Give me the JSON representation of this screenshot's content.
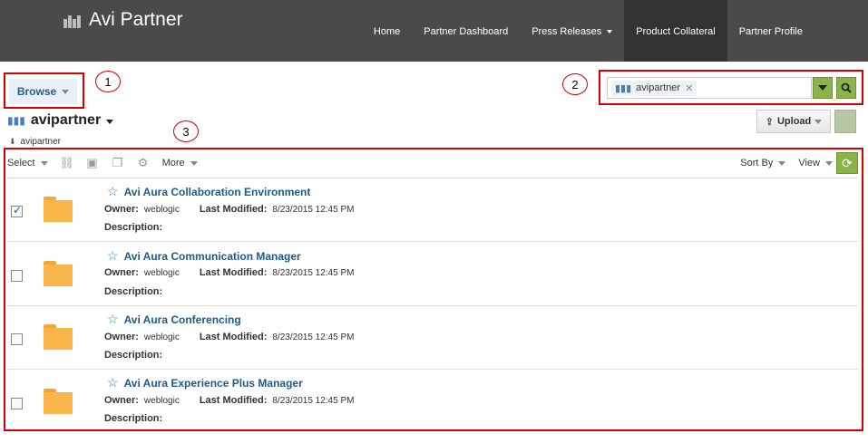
{
  "app": {
    "title": "Avi Partner"
  },
  "nav": [
    {
      "label": "Home"
    },
    {
      "label": "Partner Dashboard"
    },
    {
      "label": "Press Releases"
    },
    {
      "label": "Product Collateral"
    },
    {
      "label": "Partner Profile"
    }
  ],
  "browse": {
    "label": "Browse"
  },
  "search": {
    "token": "avipartner"
  },
  "folder": {
    "title": "avipartner",
    "breadcrumb": "avipartner"
  },
  "upload": {
    "label": "Upload"
  },
  "toolbar": {
    "select": "Select",
    "more": "More",
    "sort_by": "Sort By",
    "view": "View"
  },
  "callouts": [
    "1",
    "2",
    "3"
  ],
  "items": [
    {
      "name": "Avi Aura Collaboration Environment",
      "owner_label": "Owner:",
      "owner": "weblogic",
      "modified_label": "Last Modified:",
      "modified": "8/23/2015 12:45 PM",
      "desc_label": "Description:",
      "checked": true
    },
    {
      "name": "Avi Aura Communication Manager",
      "owner_label": "Owner:",
      "owner": "weblogic",
      "modified_label": "Last Modified:",
      "modified": "8/23/2015 12:45 PM",
      "desc_label": "Description:",
      "checked": false
    },
    {
      "name": "Avi Aura Conferencing",
      "owner_label": "Owner:",
      "owner": "weblogic",
      "modified_label": "Last Modified:",
      "modified": "8/23/2015 12:45 PM",
      "desc_label": "Description:",
      "checked": false
    },
    {
      "name": "Avi Aura Experience Plus Manager",
      "owner_label": "Owner:",
      "owner": "weblogic",
      "modified_label": "Last Modified:",
      "modified": "8/23/2015 12:45 PM",
      "desc_label": "Description:",
      "checked": false
    }
  ],
  "colors": {
    "header": "#4a4a4a",
    "accent_green": "#8ab34a",
    "callout_red": "#d40000",
    "link_blue": "#1f5a8a",
    "folder": "#f7b54a"
  }
}
